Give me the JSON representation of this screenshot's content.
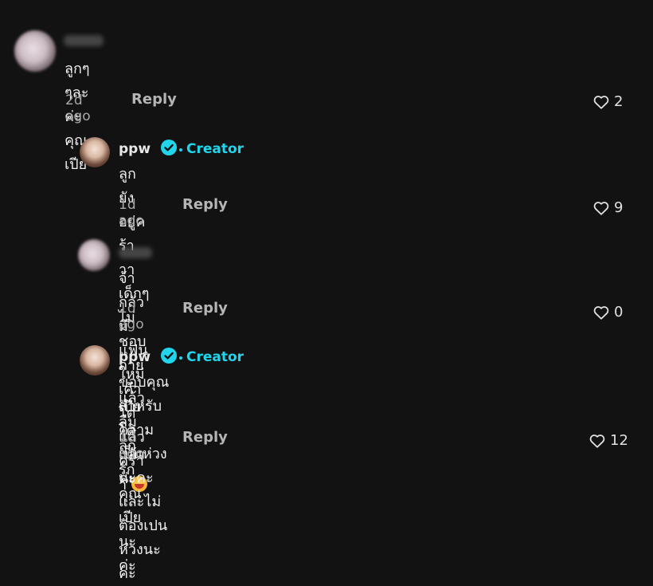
{
  "comments": [
    {
      "text": "ลูกๆๆละค่ะคุณเปีย",
      "time": "2d ago",
      "reply_label": "Reply",
      "likes": "2"
    },
    {
      "username": "ppw",
      "badge": "Creator",
      "text": "ลูกยังอยู่คร้าาา เด็กๆไม่ชอบถ่าย เค้าโตแล้วคร้าา",
      "emoji_icon": "grinning-sweat-emoji",
      "time": "1d ago",
      "reply_label": "Reply",
      "likes": "9"
    },
    {
      "text": "จ้ากลัวมีแฟนใหม่แล้วลืมลูก รักคุณเปียนะค่ะ",
      "time": "1d ago",
      "reply_label": "Reply",
      "likes": "0"
    },
    {
      "username": "ppw",
      "badge": "Creator",
      "text_line1": "ขอบคุณสำหรับความเป็นห่วงนะคะ และไม่ต้องเปนห่วงนะคะ",
      "text_line2": "เปียโตแล้วค่ะ",
      "time": "1d ago",
      "reply_label": "Reply",
      "likes": "12"
    }
  ],
  "colors": {
    "background": "#121212",
    "creator_accent": "#20d5ec",
    "muted": "#a8a8a8"
  }
}
